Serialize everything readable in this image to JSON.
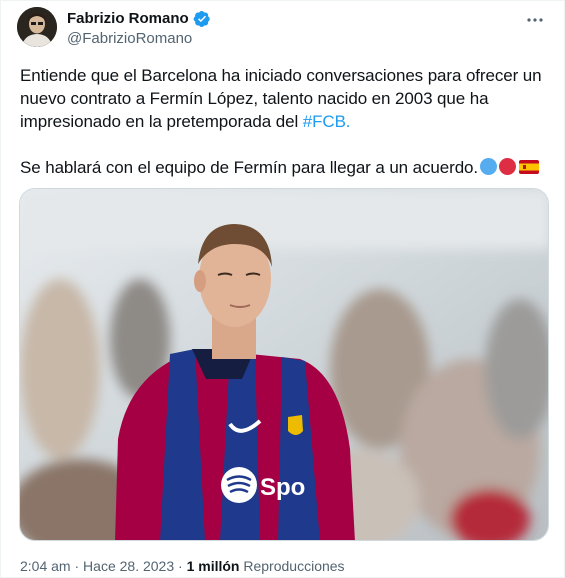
{
  "author": {
    "name": "Fabrizio Romano",
    "handle": "@FabrizioRomano",
    "verified": true
  },
  "tweet": {
    "paragraph1_text": "Entiende que el Barcelona ha iniciado conversaciones para ofrecer un nuevo contrato a Fermín López, talento nacido en 2003 que ha impresionado en la pretemporada del ",
    "hashtag": "#FCB.",
    "paragraph2_text": "Se hablará con el equipo de Fermín para llegar a un acuerdo.",
    "emojis": [
      "blue-circle-icon",
      "red-circle-icon",
      "spain-flag-icon"
    ]
  },
  "media": {
    "jersey_sponsor": "Spo"
  },
  "meta": {
    "time": "2:04 am",
    "separator": "·",
    "date": "Hace 28. 2023",
    "views_count": "1 millón",
    "views_label": "Reproducciones"
  },
  "colors": {
    "accent": "#1d9bf0",
    "secondary_text": "#536471",
    "primary_text": "#0f1419"
  }
}
